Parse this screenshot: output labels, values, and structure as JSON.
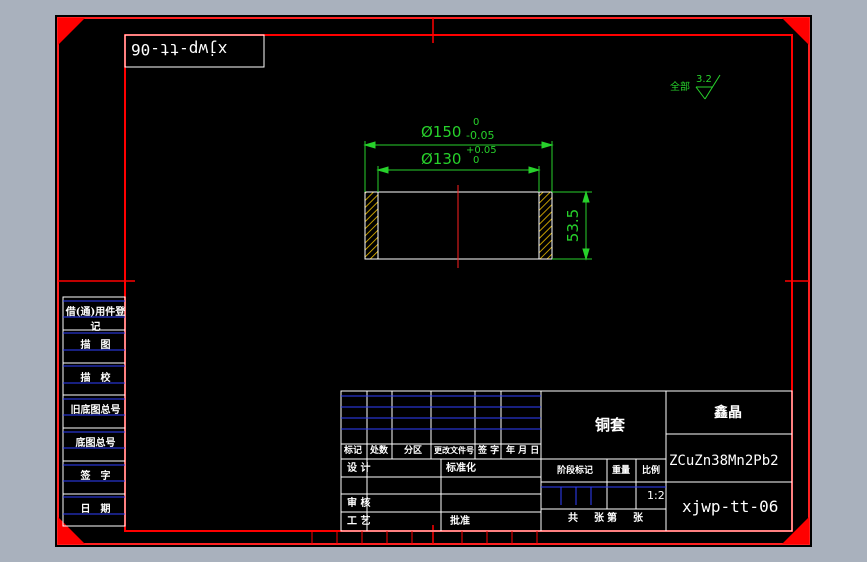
{
  "drawing": {
    "part_code_mirrored": "xjwp-tt-06",
    "roughness_prefix": "全部",
    "roughness_value": "3.2",
    "dim_outer_diameter": "Ø150",
    "dim_outer_upper": "0",
    "dim_outer_lower": "-0.05",
    "dim_inner_diameter": "Ø130",
    "dim_inner_upper": "+0.05",
    "dim_inner_lower": "0",
    "dim_height": "53.5"
  },
  "side_table": {
    "rows": [
      "借(通)用件登记",
      "描　图",
      "描　校",
      "旧底图总号",
      "底图总号",
      "签　字",
      "日　期"
    ]
  },
  "title_block": {
    "headers": [
      "标记",
      "处数",
      "分区",
      "更改文件号",
      "签 字",
      "年 月 日"
    ],
    "design": "设 计",
    "standardize": "标准化",
    "review": "审 核",
    "process": "工 艺",
    "approve": "批准",
    "part_name": "铜套",
    "company": "鑫晶",
    "material": "ZCuZn38Mn2Pb2",
    "stage_label": "阶段标记",
    "weight_label": "重量",
    "scale_label": "比例",
    "scale_value": "1:2",
    "sheet_info": "共　张第　张",
    "drawing_number": "xjwp-tt-06"
  },
  "colors": {
    "background": "#a9b1bd",
    "sheet": "#000000",
    "frame": "#ff0000",
    "dimension": "#27d12b",
    "title_lines": "#ffffff",
    "hatch": "#f2c200",
    "blue_lines": "#3040ff"
  }
}
